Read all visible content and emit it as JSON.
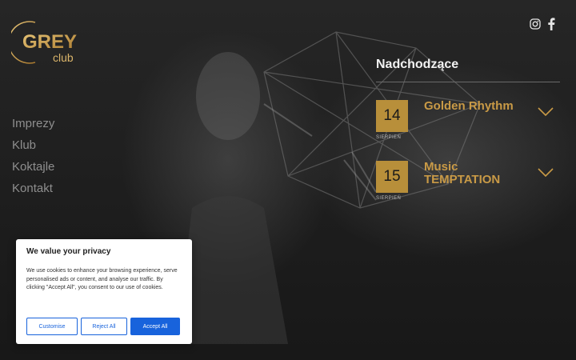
{
  "brand": {
    "logo_text": "GREY",
    "logo_sub": "club",
    "accent": "#c99a46"
  },
  "social": [
    {
      "icon": "instagram-icon"
    },
    {
      "icon": "facebook-icon"
    }
  ],
  "nav": {
    "items": [
      {
        "label": "Imprezy"
      },
      {
        "label": "Klub"
      },
      {
        "label": "Koktajle"
      },
      {
        "label": "Kontakt"
      }
    ]
  },
  "upcoming": {
    "heading": "Nadchodzące",
    "events": [
      {
        "day": "14",
        "month": "SIERPIEŃ",
        "title": "Golden Rhythm"
      },
      {
        "day": "15",
        "month": "SIERPIEŃ",
        "title": "Music TEMPTATION"
      }
    ]
  },
  "cookie": {
    "title": "We value your privacy",
    "body": "We use cookies to enhance your browsing experience, serve personalised ads or content, and analyse our traffic. By clicking \"Accept All\", you consent to our use of cookies.",
    "customise": "Customise",
    "reject": "Reject All",
    "accept": "Accept All",
    "button_color": "#1863dc"
  }
}
